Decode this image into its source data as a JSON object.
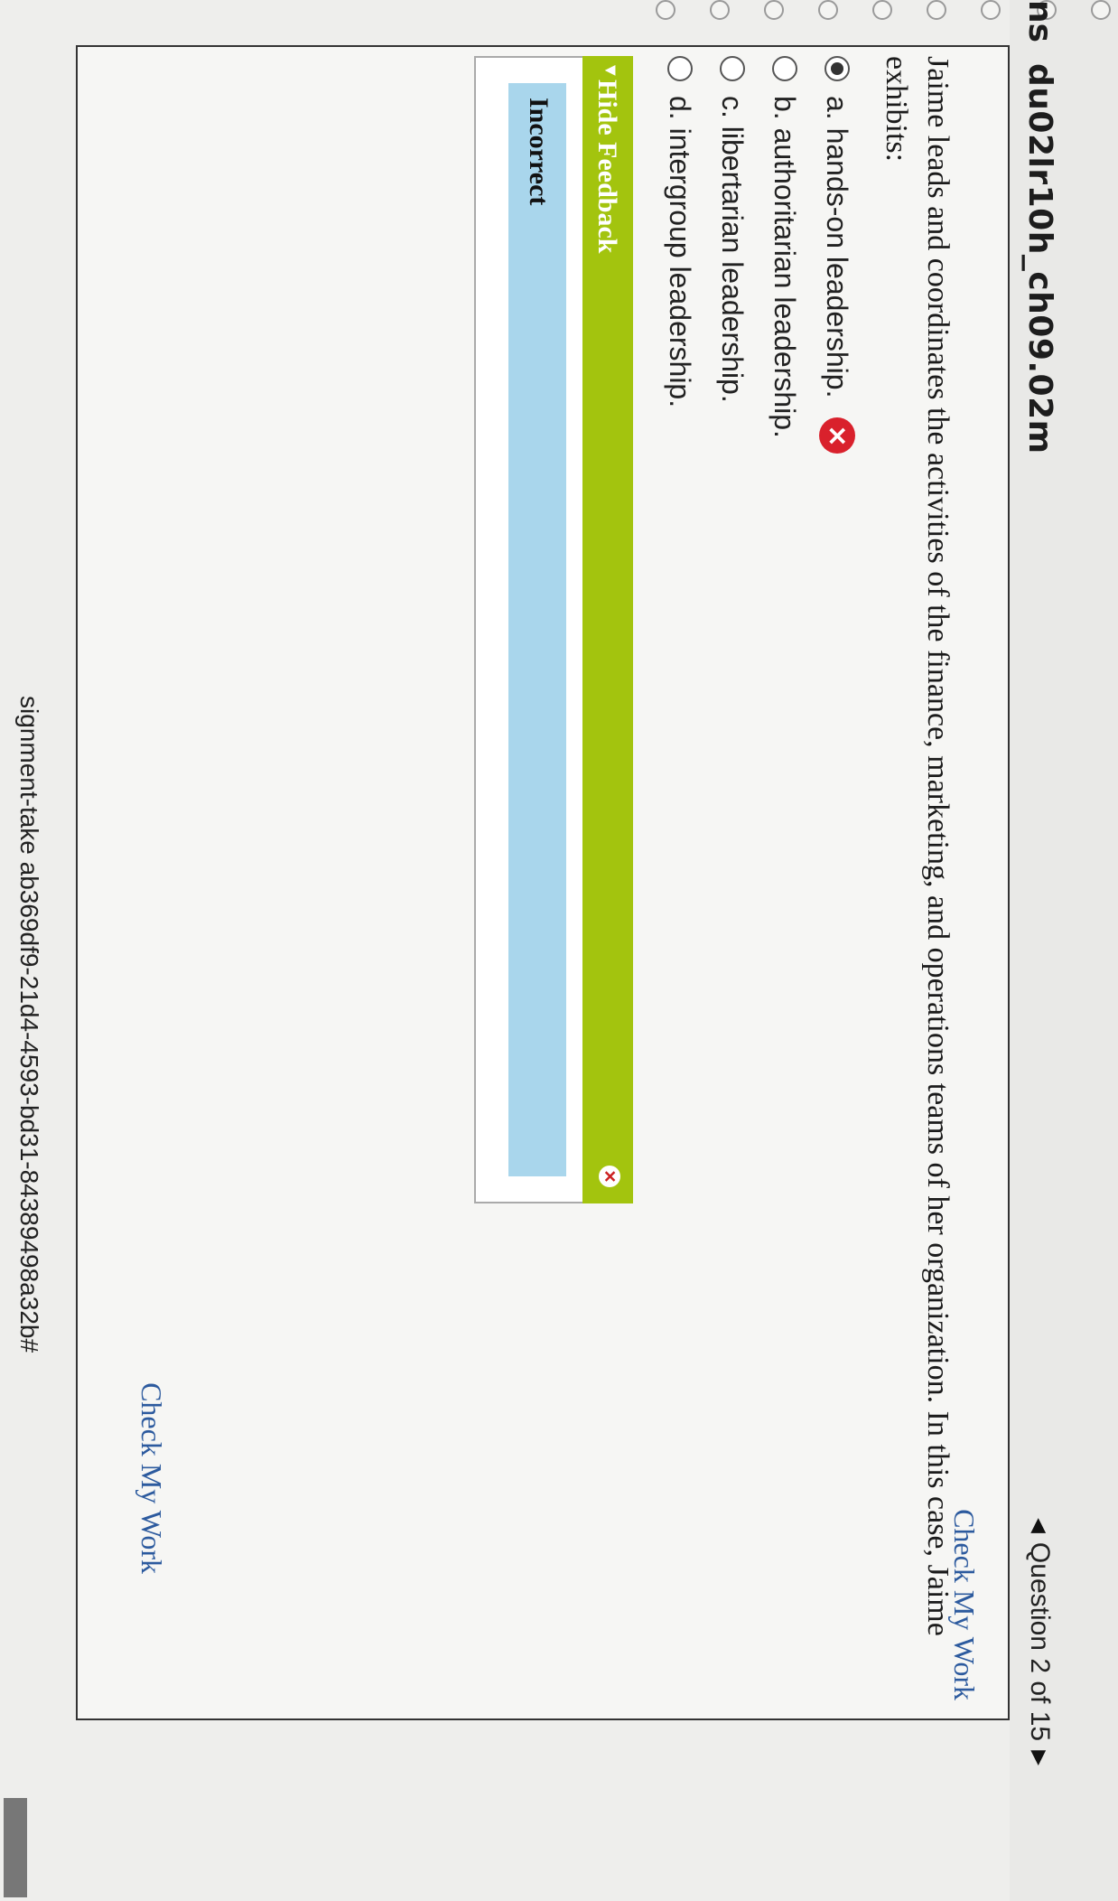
{
  "header": {
    "prefix": "ns",
    "assignment_code": "du02lr10h_ch09.02m",
    "question_counter": "Question 2 of 15"
  },
  "actions": {
    "check_my_work_top": "Check My Work",
    "check_my_work_bottom": "Check My Work"
  },
  "question": {
    "text": "Jaime leads and coordinates the activities of the finance, marketing, and operations teams of her organization. In this case, Jaime exhibits:",
    "options": [
      {
        "label": "a. hands-on leadership.",
        "selected": true,
        "marked_incorrect": true
      },
      {
        "label": "b. authoritarian leadership.",
        "selected": false
      },
      {
        "label": "c. libertarian leadership.",
        "selected": false
      },
      {
        "label": "d. intergroup leadership.",
        "selected": false
      }
    ]
  },
  "feedback": {
    "toggle_label": "Hide Feedback",
    "result": "Incorrect",
    "bar_color": "#a3c40e",
    "result_color": "#a9d6ec"
  },
  "status_bar": {
    "url_fragment": "signment-take ab369df9-21d4-4593-bd31-84389498a32b#"
  },
  "colors": {
    "link": "#2c5a9e",
    "error": "#d9212c"
  }
}
